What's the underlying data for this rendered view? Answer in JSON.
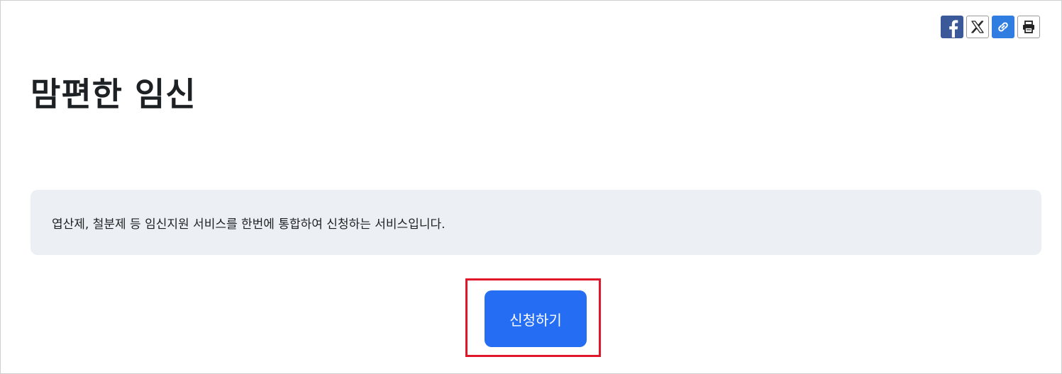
{
  "share": {
    "items": [
      {
        "icon": "facebook-icon"
      },
      {
        "icon": "x-icon"
      },
      {
        "icon": "link-icon"
      },
      {
        "icon": "printer-icon"
      }
    ]
  },
  "page": {
    "title": "맘편한 임신",
    "description": "엽산제, 철분제 등 임신지원 서비스를 한번에 통합하여 신청하는 서비스입니다.",
    "apply_label": "신청하기"
  },
  "colors": {
    "accent": "#256ef4",
    "highlight": "#e0162b",
    "box_bg": "#eceff3"
  }
}
